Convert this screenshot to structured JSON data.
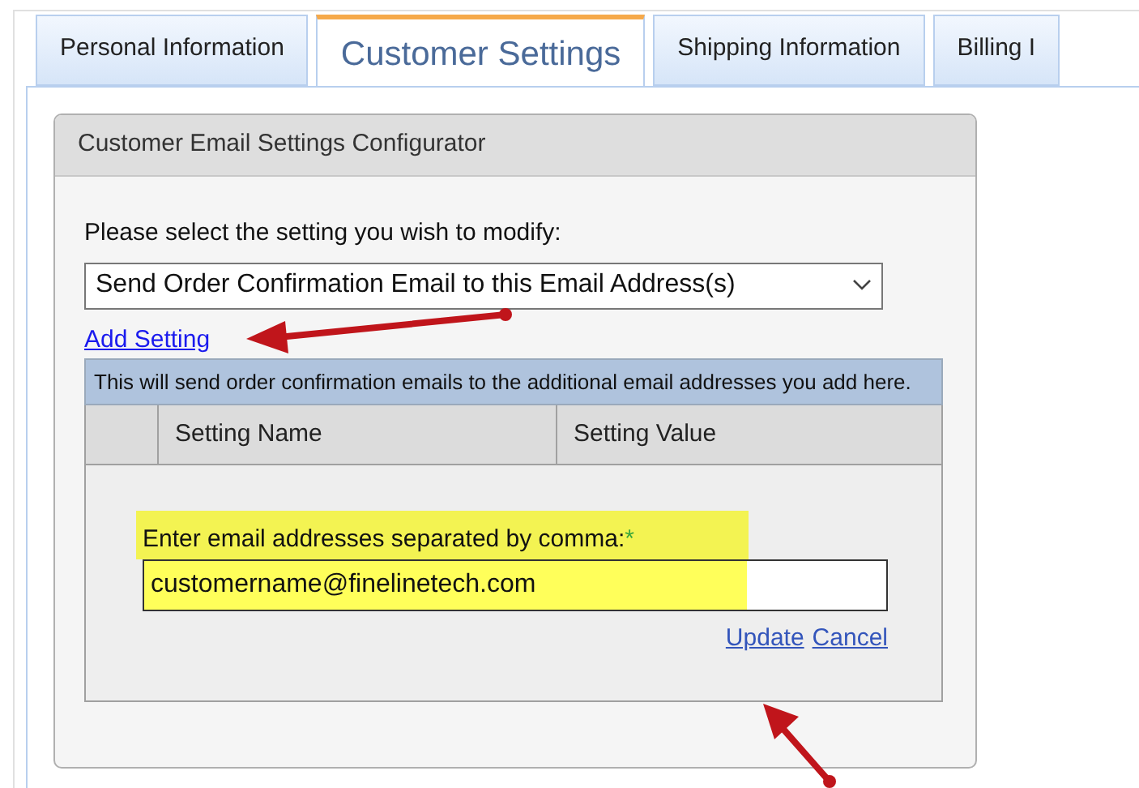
{
  "tabs": [
    {
      "label": "Personal Information",
      "selected": false
    },
    {
      "label": "Customer Settings",
      "selected": true
    },
    {
      "label": "Shipping Information",
      "selected": false
    },
    {
      "label": "Billing I",
      "selected": false
    }
  ],
  "panel": {
    "title": "Customer Email Settings Configurator",
    "prompt": "Please select the setting you wish to modify:",
    "setting_select": {
      "value": "Send Order Confirmation Email to this Email Address(s)"
    },
    "add_link": "Add Setting",
    "description": "This will send order confirmation emails to the additional email addresses you add here.",
    "table": {
      "columns": [
        "Setting Name",
        "Setting Value"
      ]
    },
    "editor": {
      "label": "Enter email addresses separated by comma:",
      "required_mark": "*",
      "highlighted": true,
      "value": "customername@finelinetech.com",
      "actions": [
        "Update",
        "Cancel"
      ]
    }
  }
}
